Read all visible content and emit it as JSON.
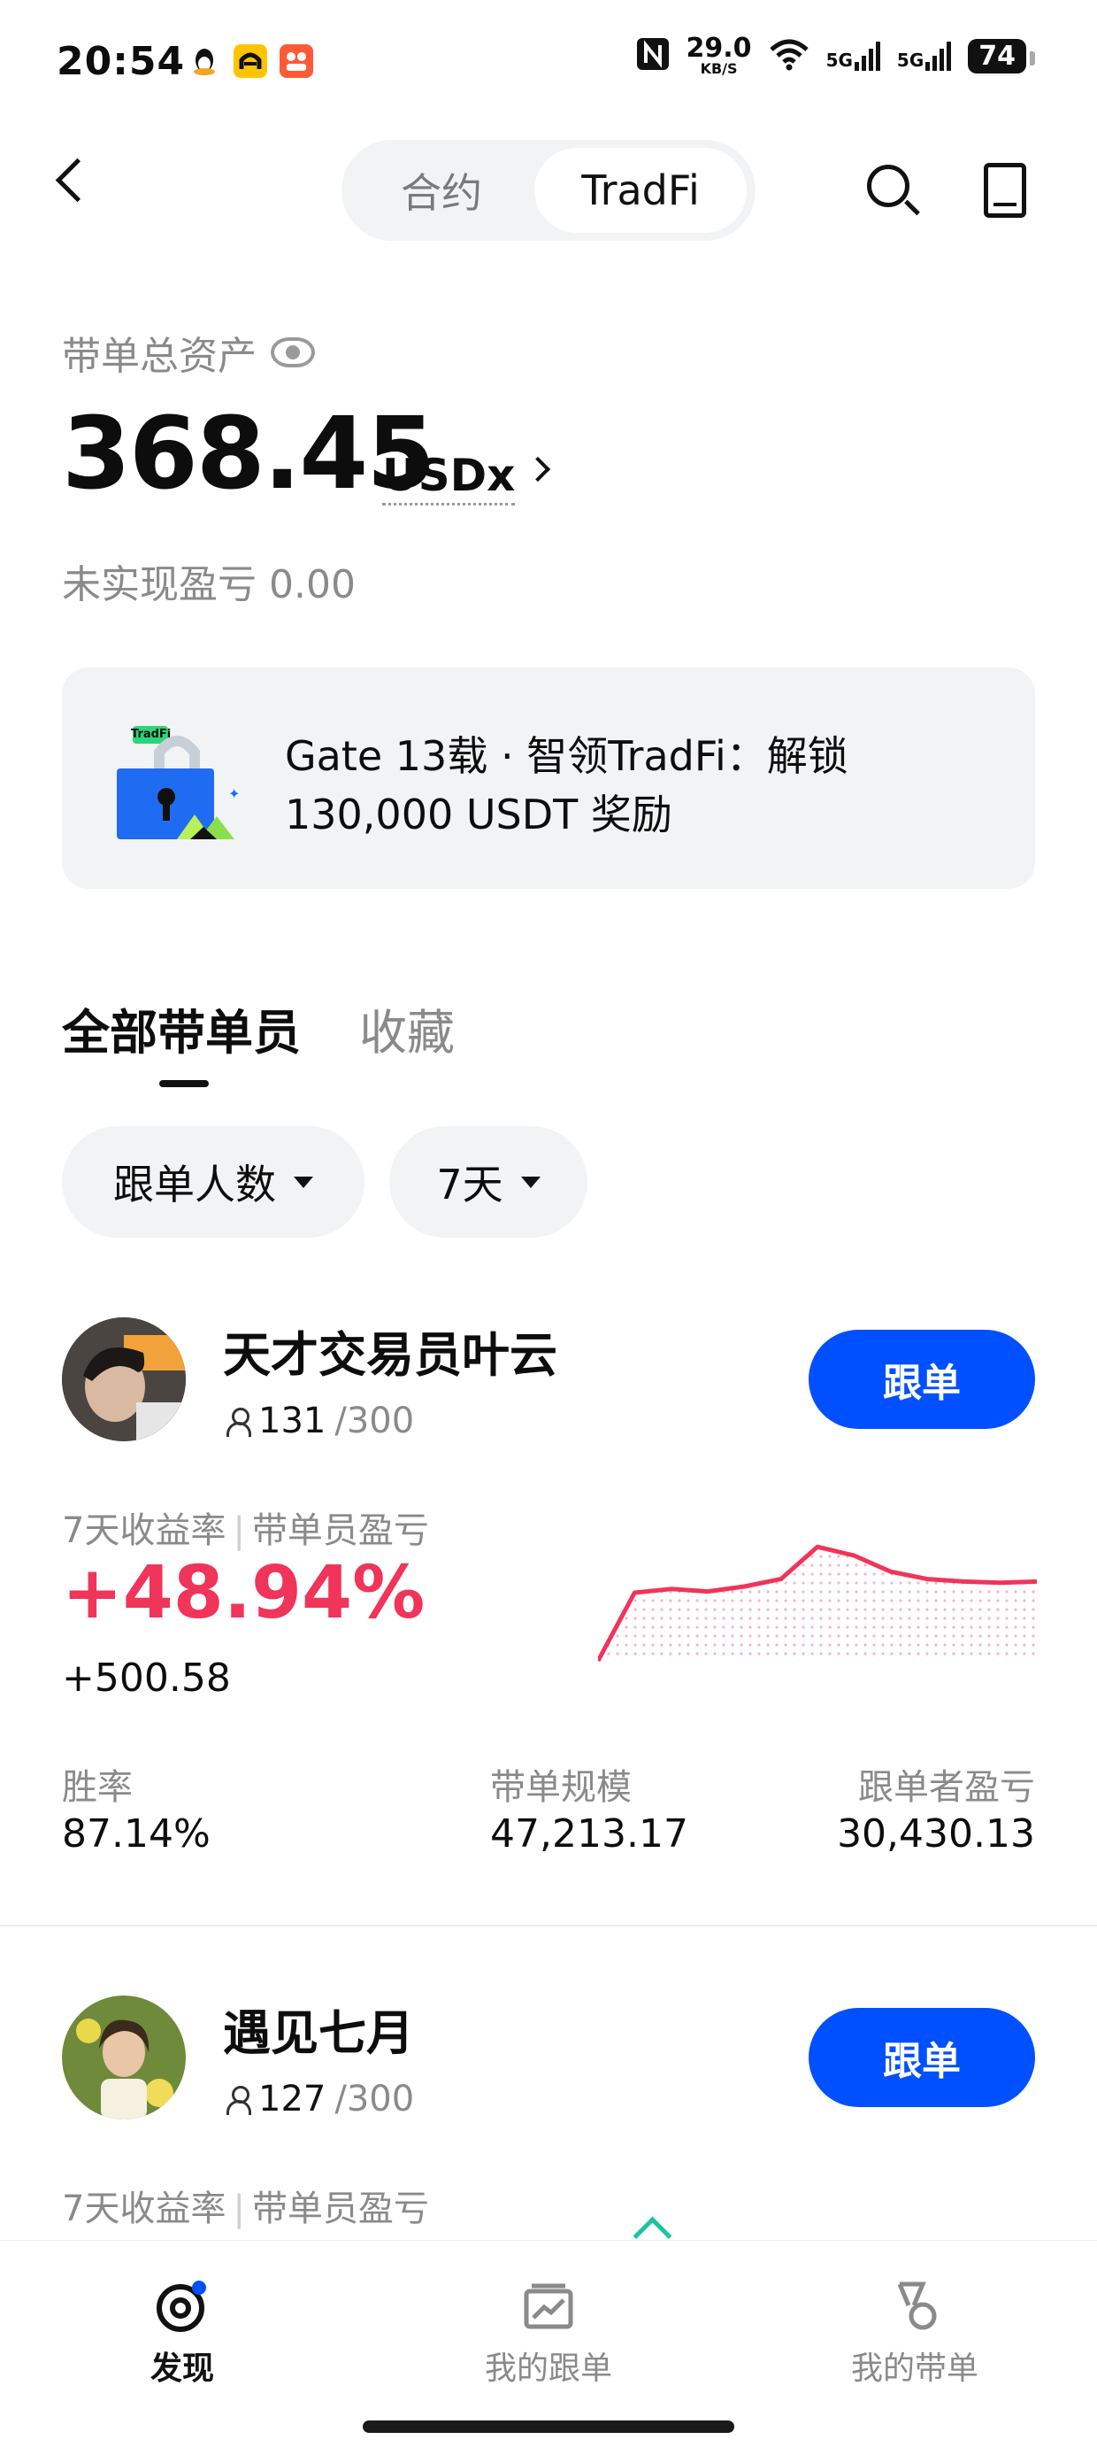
{
  "status_bar": {
    "time": "20:54",
    "net_speed": "29.0",
    "net_unit": "KB/S",
    "signal1": "5G",
    "signal2": "5G",
    "battery": "74"
  },
  "header": {
    "tabs": [
      "合约",
      "TradFi"
    ],
    "active_tab": "TradFi"
  },
  "assets": {
    "label": "带单总资产",
    "value": "368.45",
    "unit": "USDx",
    "unrealized_label": "未实现盈亏",
    "unrealized_value": "0.00"
  },
  "banner": {
    "line1": "Gate 13载 · 智领TradFi：解锁",
    "line2": "130,000 USDT 奖励",
    "art_label": "TradFi"
  },
  "list_tabs": {
    "all": "全部带单员",
    "favorites": "收藏"
  },
  "filters": {
    "sort": "跟单人数",
    "period": "7天"
  },
  "traders": [
    {
      "name": "天才交易员叶云",
      "followers": "131",
      "max_followers": "/300",
      "follow_label": "跟单",
      "roi_label": "7天收益率",
      "pnl_label": "带单员盈亏",
      "roi": "+48.94%",
      "pnl": "+500.58",
      "win_rate_label": "胜率",
      "win_rate": "87.14%",
      "scale_label": "带单规模",
      "scale": "47,213.17",
      "follower_pnl_label": "跟单者盈亏",
      "follower_pnl": "30,430.13",
      "sparkline": [
        0.0,
        0.55,
        0.58,
        0.56,
        0.6,
        0.66,
        0.92,
        0.85,
        0.72,
        0.66,
        0.64,
        0.63,
        0.64
      ]
    },
    {
      "name": "遇见七月",
      "followers": "127",
      "max_followers": "/300",
      "follow_label": "跟单",
      "roi_label": "7天收益率",
      "pnl_label": "带单员盈亏"
    }
  ],
  "bottom_nav": {
    "discover": "发现",
    "my_follow": "我的跟单",
    "my_lead": "我的带单"
  },
  "colors": {
    "accent": "#0050ff",
    "profit": "#f0345a",
    "muted": "#8a8a8a",
    "surface": "#f2f3f5"
  }
}
